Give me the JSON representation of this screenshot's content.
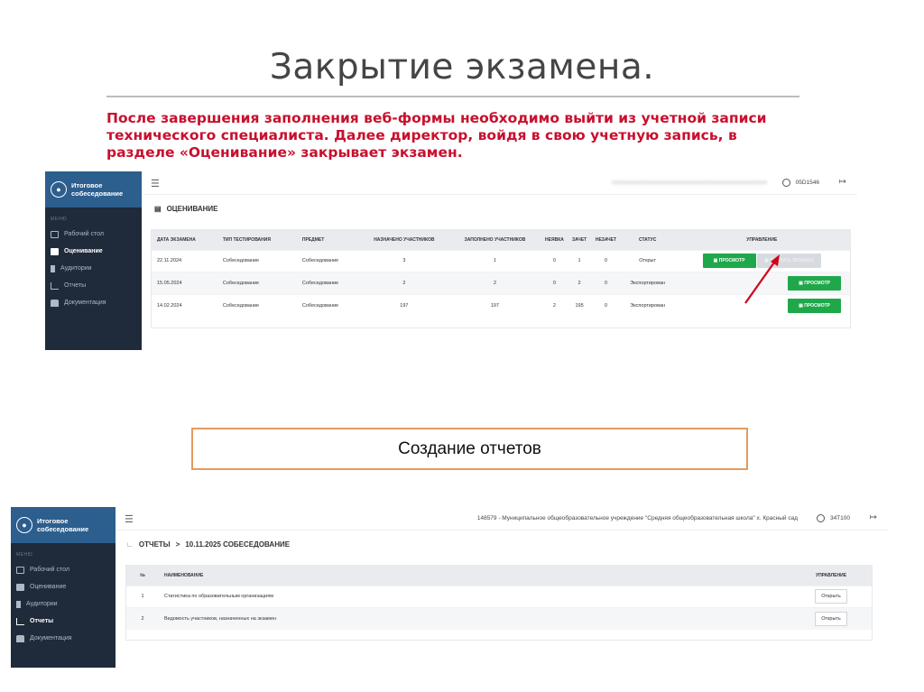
{
  "slide": {
    "title": "Закрытие экзамена.",
    "instruction": "После завершения заполнения веб-формы необходимо выйти из учетной записи технического специалиста. Далее директор, войдя в свою учетную запись, в разделе «Оценивание» закрывает экзамен.",
    "box_label": "Создание отчетов"
  },
  "colors": {
    "accent_red": "#c8102e",
    "sidebar": "#1f2a3a",
    "sidebar_head": "#2c5e8e",
    "green": "#1fa84a",
    "box_border": "#e39b5e"
  },
  "app1": {
    "brand_line1": "Итоговое",
    "brand_line2": "собеседование",
    "menu_caption": "МЕНЮ",
    "nav": [
      {
        "label": "Рабочий стол",
        "icon": "monitor-icon"
      },
      {
        "label": "Оценивание",
        "icon": "checklist-icon",
        "active": true
      },
      {
        "label": "Аудитории",
        "icon": "door-icon"
      },
      {
        "label": "Отчеты",
        "icon": "chart-icon"
      },
      {
        "label": "Документация",
        "icon": "docs-icon"
      }
    ],
    "user_code": "05D1546",
    "section_title": "ОЦЕНИВАНИЕ",
    "columns": [
      "ДАТА ЭКЗАМЕНА",
      "ТИП ТЕСТИРОВАНИЯ",
      "ПРЕДМЕТ",
      "НАЗНАЧЕНО УЧАСТНИКОВ",
      "ЗАПОЛНЕНО УЧАСТНИКОВ",
      "НЕЯВКА",
      "ЗАЧЕТ",
      "НЕЗАЧЕТ",
      "СТАТУС",
      "УПРАВЛЕНИЕ"
    ],
    "rows": [
      {
        "date": "22.11.2024",
        "type": "Собеседование",
        "subject": "Собеседование",
        "assigned": "3",
        "filled": "1",
        "absent": "0",
        "pass": "1",
        "fail": "0",
        "status": "Открыт",
        "btn_view": "ПРОСМОТР",
        "btn_close": "ЗАКРЫТЬ ЭКЗАМЕН"
      },
      {
        "date": "15.05.2024",
        "type": "Собеседование",
        "subject": "Собеседование",
        "assigned": "2",
        "filled": "2",
        "absent": "0",
        "pass": "2",
        "fail": "0",
        "status": "Экспортирован",
        "btn_view": "ПРОСМОТР"
      },
      {
        "date": "14.02.2024",
        "type": "Собеседование",
        "subject": "Собеседование",
        "assigned": "197",
        "filled": "197",
        "absent": "2",
        "pass": "195",
        "fail": "0",
        "status": "Экспортирован",
        "btn_view": "ПРОСМОТР"
      }
    ]
  },
  "app2": {
    "brand_line1": "Итоговое",
    "brand_line2": "собеседование",
    "menu_caption": "МЕНЮ",
    "nav": [
      {
        "label": "Рабочий стол",
        "icon": "monitor-icon"
      },
      {
        "label": "Оценивание",
        "icon": "checklist-icon"
      },
      {
        "label": "Аудитории",
        "icon": "door-icon"
      },
      {
        "label": "Отчеты",
        "icon": "chart-icon",
        "active": true
      },
      {
        "label": "Документация",
        "icon": "docs-icon"
      }
    ],
    "org": "148579 - Муниципальное общеобразовательное учреждение \"Средняя общеобразовательная школа\" х. Красный сад",
    "user_code": "34T100",
    "breadcrumb_root": "ОТЧЕТЫ",
    "breadcrumb_sep": ">",
    "breadcrumb_current": "10.11.2025 СОБЕСЕДОВАНИЕ",
    "columns": [
      "№",
      "НАИМЕНОВАНИЕ",
      "УПРАВЛЕНИЕ"
    ],
    "rows": [
      {
        "n": "1",
        "name": "Статистика по образовательным организациям",
        "btn": "Открыть"
      },
      {
        "n": "2",
        "name": "Ведомость участников, назначенных на экзамен",
        "btn": "Открыть"
      }
    ]
  }
}
